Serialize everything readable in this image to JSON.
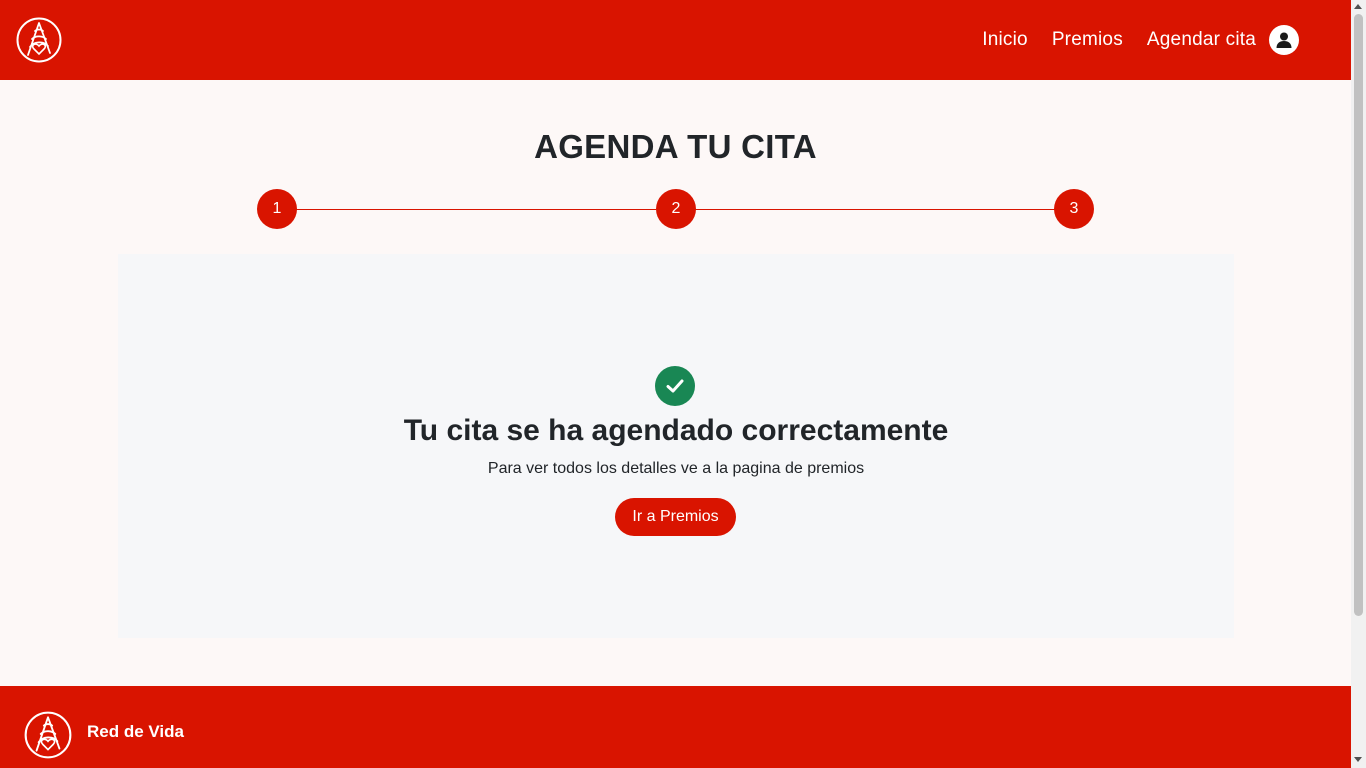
{
  "colors": {
    "brand": "#d91400",
    "success": "#198754",
    "card_bg": "#f6f7f9",
    "page_bg": "#fdf8f7"
  },
  "navbar": {
    "logo_icon": "tree-heart-logo-icon",
    "links": [
      {
        "label": "Inicio"
      },
      {
        "label": "Premios"
      },
      {
        "label": "Agendar cita"
      }
    ],
    "user_icon": "user-icon"
  },
  "main": {
    "title": "AGENDA TU CITA",
    "steps": [
      {
        "label": "1"
      },
      {
        "label": "2"
      },
      {
        "label": "3"
      }
    ],
    "card": {
      "icon": "check-circle-icon",
      "title": "Tu cita se ha agendado correctamente",
      "subtitle": "Para ver todos los detalles ve a la pagina de premios",
      "button_label": "Ir a Premios"
    }
  },
  "footer": {
    "logo_icon": "tree-heart-logo-icon",
    "brand": "Red de Vida"
  }
}
